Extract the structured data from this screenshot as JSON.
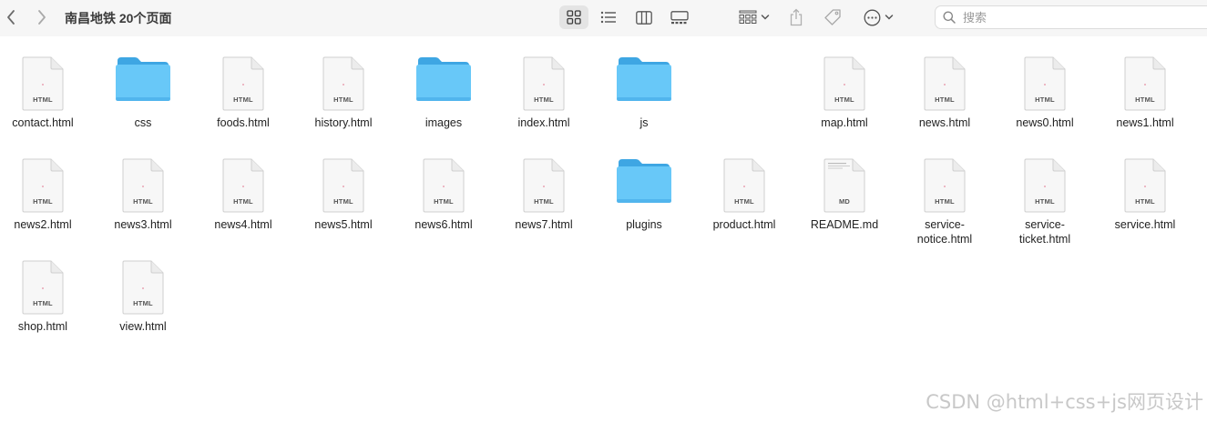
{
  "window": {
    "title": "南昌地铁 20个页面"
  },
  "toolbar": {
    "back_icon": "chevron-left-icon",
    "forward_icon": "chevron-right-icon",
    "views": [
      "icon-view",
      "list-view",
      "column-view",
      "gallery-view"
    ],
    "selected_view": "icon-view",
    "search_placeholder": "搜索"
  },
  "files": [
    {
      "name": "contact.html",
      "type": "html",
      "badge": "HTML"
    },
    {
      "name": "css",
      "type": "folder"
    },
    {
      "name": "foods.html",
      "type": "html",
      "badge": "HTML"
    },
    {
      "name": "history.html",
      "type": "html",
      "badge": "HTML"
    },
    {
      "name": "images",
      "type": "folder"
    },
    {
      "name": "index.html",
      "type": "html",
      "badge": "HTML"
    },
    {
      "name": "js",
      "type": "folder"
    },
    {
      "name": "map.html",
      "type": "html",
      "badge": "HTML"
    },
    {
      "name": "news.html",
      "type": "html",
      "badge": "HTML"
    },
    {
      "name": "news0.html",
      "type": "html",
      "badge": "HTML"
    },
    {
      "name": "news1.html",
      "type": "html",
      "badge": "HTML"
    },
    {
      "name": "news2.html",
      "type": "html",
      "badge": "HTML"
    },
    {
      "name": "news3.html",
      "type": "html",
      "badge": "HTML"
    },
    {
      "name": "news4.html",
      "type": "html",
      "badge": "HTML"
    },
    {
      "name": "news5.html",
      "type": "html",
      "badge": "HTML"
    },
    {
      "name": "news6.html",
      "type": "html",
      "badge": "HTML"
    },
    {
      "name": "news7.html",
      "type": "html",
      "badge": "HTML"
    },
    {
      "name": "plugins",
      "type": "folder"
    },
    {
      "name": "product.html",
      "type": "html",
      "badge": "HTML"
    },
    {
      "name": "README.md",
      "type": "md",
      "badge": "MD"
    },
    {
      "name": "service-\nnotice.html",
      "type": "html",
      "badge": "HTML"
    },
    {
      "name": "service-\nticket.html",
      "type": "html",
      "badge": "HTML"
    },
    {
      "name": "service.html",
      "type": "html",
      "badge": "HTML"
    },
    {
      "name": "shop.html",
      "type": "html",
      "badge": "HTML"
    },
    {
      "name": "view.html",
      "type": "html",
      "badge": "HTML"
    }
  ],
  "colors": {
    "folder_front": "#68c8f8",
    "folder_back": "#3ea6e3",
    "toolbar_bg": "#f6f6f6"
  },
  "watermark": "CSDN @html+css+js网页设计"
}
